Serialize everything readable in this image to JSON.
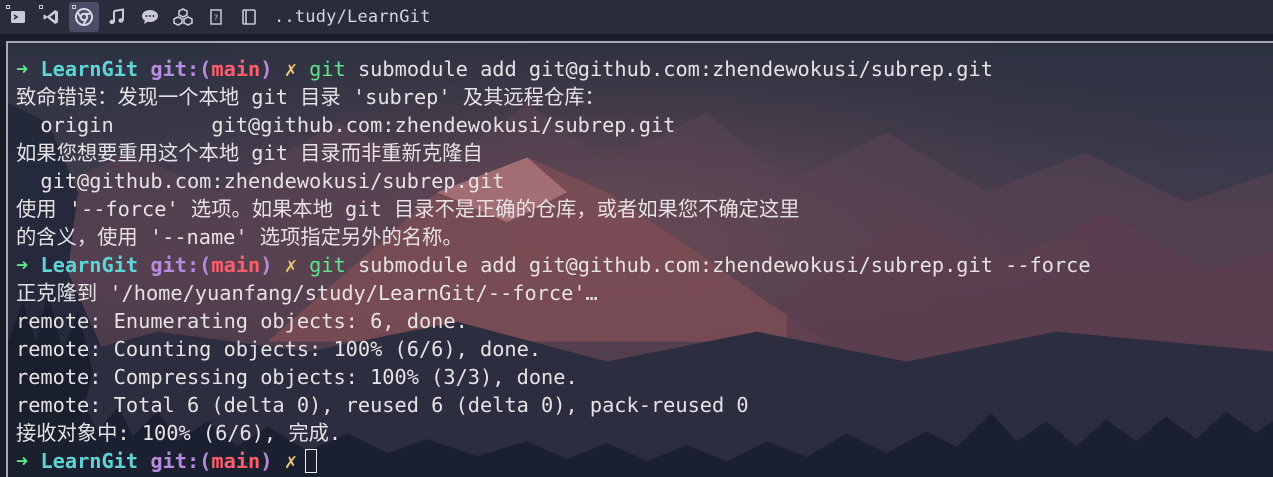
{
  "topbar": {
    "icons": [
      "terminal-icon",
      "vscode-icon",
      "chrome-icon",
      "music-icon",
      "chat-icon",
      "cubes-icon",
      "file-icon",
      "book-icon"
    ],
    "title": "..tudy/LearnGit"
  },
  "terminal": {
    "prompt": {
      "arrow": "➜",
      "dir": "LearnGit",
      "git_prefix": "git:(",
      "branch": "main",
      "git_suffix": ")",
      "dirty_mark": "✗"
    },
    "cmd1": {
      "program": "git",
      "args": " submodule add git@github.com:zhendewokusi/subrep.git"
    },
    "output1": [
      "致命错误：发现一个本地 git 目录 'subrep' 及其远程仓库：",
      "  origin        git@github.com:zhendewokusi/subrep.git",
      "如果您想要重用这个本地 git 目录而非重新克隆自",
      "  git@github.com:zhendewokusi/subrep.git",
      "使用 '--force' 选项。如果本地 git 目录不是正确的仓库，或者如果您不确定这里",
      "的含义，使用 '--name' 选项指定另外的名称。"
    ],
    "cmd2": {
      "program": "git",
      "args": " submodule add git@github.com:zhendewokusi/subrep.git --force"
    },
    "output2": [
      "正克隆到 '/home/yuanfang/study/LearnGit/--force'…",
      "remote: Enumerating objects: 6, done.",
      "remote: Counting objects: 100% (6/6), done.",
      "remote: Compressing objects: 100% (3/3), done.",
      "remote: Total 6 (delta 0), reused 6 (delta 0), pack-reused 0",
      "接收对象中: 100% (6/6), 完成."
    ]
  }
}
